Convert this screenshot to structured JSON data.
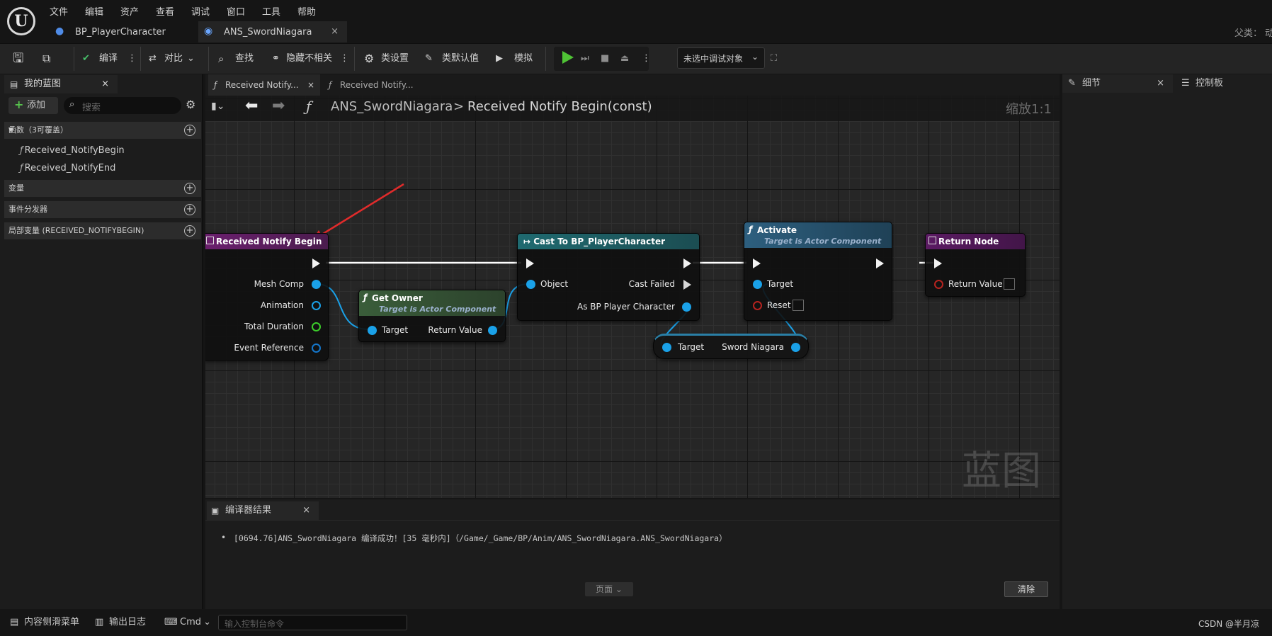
{
  "menu": [
    "文件",
    "编辑",
    "资产",
    "查看",
    "调试",
    "窗口",
    "工具",
    "帮助"
  ],
  "doc_tabs": [
    {
      "label": "BP_PlayerCharacter"
    },
    {
      "label": "ANS_SwordNiagara",
      "close": "×"
    }
  ],
  "parent_label": "父类：",
  "parent_value": "动",
  "toolbar": {
    "compile": "编译",
    "diff": "对比",
    "find": "查找",
    "hide_unrelated": "隐藏不相关",
    "class_settings": "类设置",
    "class_defaults": "类默认值",
    "simulate": "模拟",
    "debug_target": "未选中调试对象"
  },
  "my_blueprint": {
    "tab": "我的蓝图",
    "close": "×",
    "add": "添加",
    "search_placeholder": "搜索",
    "sections": [
      {
        "label": "函数（3可覆盖）"
      },
      {
        "label": "变量"
      },
      {
        "label": "事件分发器"
      },
      {
        "label": "局部变量 (RECEIVED_NOTIFYBEGIN)"
      }
    ],
    "functions": [
      "Received_NotifyBegin",
      "Received_NotifyEnd"
    ]
  },
  "graph_tabs": [
    "Received Notify...",
    "Received Notify..."
  ],
  "graph_tab_close": "×",
  "breadcrumb": {
    "root": "ANS_SwordNiagara",
    "sep": ">",
    "current": "Received Notify Begin(const)",
    "zoom": "缩放1:1"
  },
  "nodes": {
    "received": {
      "title": "Received Notify Begin",
      "pins": [
        "Mesh Comp",
        "Animation",
        "Total Duration",
        "Event Reference"
      ]
    },
    "get_owner": {
      "title": "Get Owner",
      "subtitle": "Target is Actor Component",
      "in": "Target",
      "out": "Return Value"
    },
    "cast": {
      "title": "Cast To BP_PlayerCharacter",
      "in": "Object",
      "failed": "Cast Failed",
      "out": "As BP Player Character"
    },
    "activate": {
      "title": "Activate",
      "subtitle": "Target is Actor Component",
      "in": "Target",
      "reset": "Reset"
    },
    "getter": {
      "in": "Target",
      "out": "Sword Niagara"
    },
    "return": {
      "title": "Return Node",
      "pin": "Return Value"
    }
  },
  "watermark": "蓝图",
  "compiler": {
    "tab": "编译器结果",
    "close": "×",
    "message": "[0694.76]ANS_SwordNiagara 编译成功！[35 毫秒内]（/Game/_Game/BP/Anim/ANS_SwordNiagara.ANS_SwordNiagara）",
    "page": "页面",
    "clear": "清除"
  },
  "details": {
    "tab": "细节",
    "close": "×"
  },
  "control_panel": {
    "tab": "控制板"
  },
  "statusbar": {
    "content_drawer": "内容侧滑菜单",
    "output_log": "输出日志",
    "cmd": "Cmd",
    "console_placeholder": "输入控制台命令",
    "right": "CSDN @半月凉"
  },
  "colors": {
    "event_header": "#6b1f6e",
    "pure_header": "#3a5d3a",
    "cast_header": "#1f6a70",
    "function_header": "#2d5f7f",
    "return_header": "#5b1b63",
    "exec_wire": "#ffffff",
    "object_wire": "#1aa1e8",
    "arrow": "#e02b2b"
  }
}
